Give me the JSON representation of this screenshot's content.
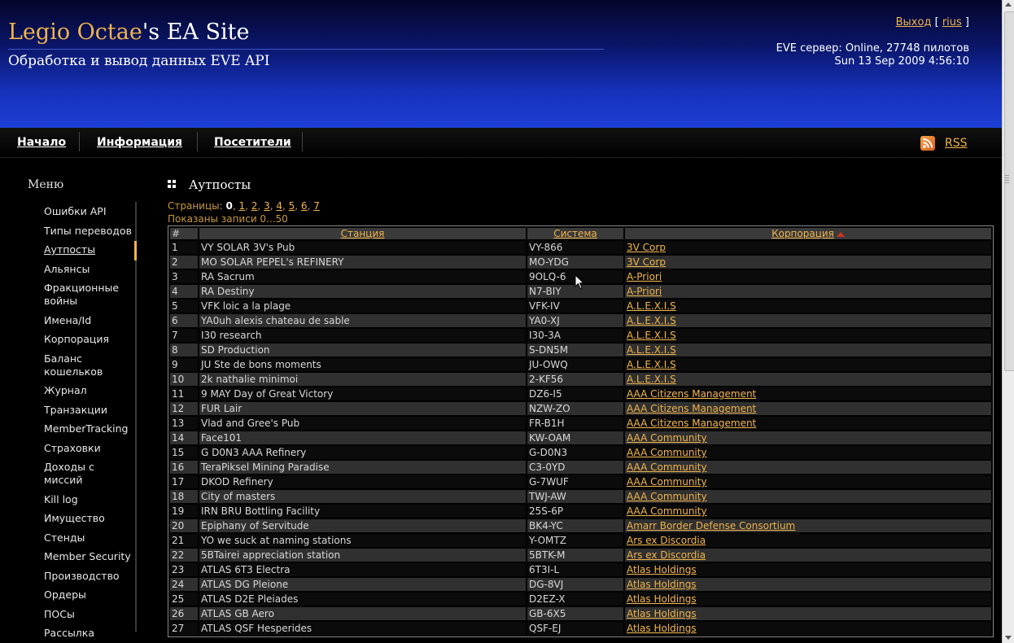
{
  "header": {
    "title_accent": "Legio Octae",
    "title_rest": "'s EA Site",
    "subtitle": "Обработка и вывод данных EVE API",
    "logout": "Выход",
    "bracket_open": "[",
    "username": "rius",
    "bracket_close": "]",
    "server_status": "EVE сервер: Online, 27748 пилотов",
    "datetime": "Sun 13 Sep 2009 4:56:10"
  },
  "nav": {
    "items": [
      "Начало",
      "Информация",
      "Посетители"
    ],
    "rss": "RSS"
  },
  "sidebar": {
    "title": "Меню",
    "items": [
      "Ошибки API",
      "Типы переводов",
      "Аутпосты",
      "Альянсы",
      "Фракционные войны",
      "Имена/Id",
      "Корпорация",
      "Баланс кошельков",
      "Журнал",
      "Транзакции",
      "MemberTracking",
      "Страховки",
      "Доходы с миссий",
      "Kill log",
      "Имущество",
      "Стенды",
      "Member Security",
      "Производство",
      "Ордеры",
      "ПОСы",
      "Рассылка"
    ],
    "active_index": 2
  },
  "content": {
    "title": "Аутпосты",
    "pages_label": "Страницы:",
    "pages": [
      "0",
      "1",
      "2",
      "3",
      "4",
      "5",
      "6",
      "7"
    ],
    "current_page": "0",
    "records": "Показаны записи 0...50"
  },
  "table": {
    "columns": [
      "#",
      "Станция",
      "Система",
      "Корпорация"
    ],
    "sorted_column": "Корпорация",
    "rows": [
      [
        "1",
        "VY SOLAR 3V's Pub",
        "VY-866",
        "3V Corp"
      ],
      [
        "2",
        "MO SOLAR PEPEL's REFINERY",
        "MO-YDG",
        "3V Corp"
      ],
      [
        "3",
        "RA Sacrum",
        "9OLQ-6",
        "A-Priori"
      ],
      [
        "4",
        "RA Destiny",
        "N7-BIY",
        "A-Priori"
      ],
      [
        "5",
        "VFK loic a la plage",
        "VFK-IV",
        "A.L.E.X.I.S"
      ],
      [
        "6",
        "YA0uh alexis chateau de sable",
        "YA0-XJ",
        "A.L.E.X.I.S"
      ],
      [
        "7",
        "I30 research",
        "I30-3A",
        "A.L.E.X.I.S"
      ],
      [
        "8",
        "SD Production",
        "S-DN5M",
        "A.L.E.X.I.S"
      ],
      [
        "9",
        "JU Ste de bons moments",
        "JU-OWQ",
        "A.L.E.X.I.S"
      ],
      [
        "10",
        "2k nathalie minimoi",
        "2-KF56",
        "A.L.E.X.I.S"
      ],
      [
        "11",
        "9 MAY Day of Great Victory",
        "DZ6-I5",
        "AAA Citizens Management"
      ],
      [
        "12",
        "FUR Lair",
        "NZW-ZO",
        "AAA Citizens Management"
      ],
      [
        "13",
        "Vlad and Gree's Pub",
        "FR-B1H",
        "AAA Citizens Management"
      ],
      [
        "14",
        "Face101",
        "KW-OAM",
        "AAA Community"
      ],
      [
        "15",
        "G D0N3 AAA Refinery",
        "G-D0N3",
        "AAA Community"
      ],
      [
        "16",
        "TeraPiksel Mining Paradise",
        "C3-0YD",
        "AAA Community"
      ],
      [
        "17",
        "DKOD Refinery",
        "G-7WUF",
        "AAA Community"
      ],
      [
        "18",
        "City of masters",
        "TWJ-AW",
        "AAA Community"
      ],
      [
        "19",
        "IRN BRU Bottling Facility",
        "25S-6P",
        "AAA Community"
      ],
      [
        "20",
        "Epiphany of Servitude",
        "BK4-YC",
        "Amarr Border Defense Consortium"
      ],
      [
        "21",
        "YO we suck at naming stations",
        "Y-OMTZ",
        "Ars ex Discordia"
      ],
      [
        "22",
        "5BTairei appreciation station",
        "5BTK-M",
        "Ars ex Discordia"
      ],
      [
        "23",
        "ATLAS 6T3 Electra",
        "6T3I-L",
        "Atlas Holdings"
      ],
      [
        "24",
        "ATLAS DG Pleione",
        "DG-8VJ",
        "Atlas Holdings"
      ],
      [
        "25",
        "ATLAS D2E Pleiades",
        "D2EZ-X",
        "Atlas Holdings"
      ],
      [
        "26",
        "ATLAS GB Aero",
        "GB-6X5",
        "Atlas Holdings"
      ],
      [
        "27",
        "ATLAS QSF Hesperides",
        "QSF-EJ",
        "Atlas Holdings"
      ]
    ]
  },
  "colors": {
    "accent": "#f0b44c",
    "header_gradient_top": "#04062a",
    "header_gradient_bottom": "#1e40d6",
    "row_dark": "#0b0b0b",
    "row_light": "#303030"
  },
  "icons": [
    "rss-icon",
    "grid-icon",
    "sort-asc-icon",
    "mouse-cursor-icon"
  ]
}
